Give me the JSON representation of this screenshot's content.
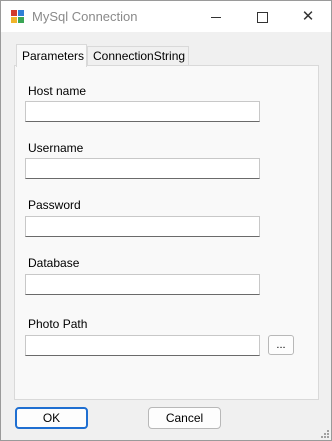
{
  "window": {
    "title": "MySql Connection",
    "controls": {
      "minimize": "minimize",
      "maximize": "maximize",
      "close": "✕"
    }
  },
  "tabs": [
    {
      "label": "Parameters",
      "selected": true
    },
    {
      "label": "ConnectionString",
      "selected": false
    }
  ],
  "form": {
    "host_label": "Host name",
    "host_value": "",
    "username_label": "Username",
    "username_value": "",
    "password_label": "Password",
    "password_value": "",
    "database_label": "Database",
    "database_value": "",
    "photo_label": "Photo Path",
    "photo_value": "",
    "browse_label": "..."
  },
  "buttons": {
    "ok": "OK",
    "cancel": "Cancel"
  },
  "colors": {
    "accent": "#1f6fd1",
    "window_bg": "#f0f0f0",
    "tab_bg": "#f9f9f9"
  }
}
